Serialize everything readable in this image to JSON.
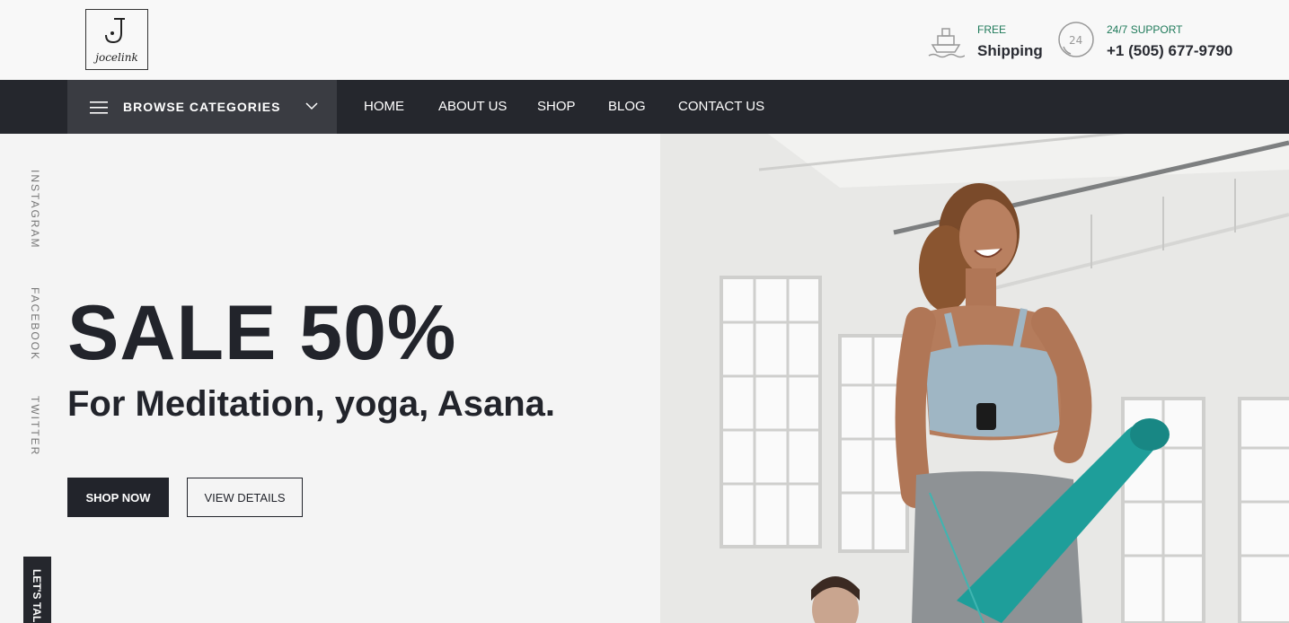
{
  "brand": {
    "logo_text": "jocelink"
  },
  "header": {
    "shipping": {
      "small": "FREE",
      "big": "Shipping",
      "icon": "ship-icon"
    },
    "support": {
      "small": "24/7 SUPPORT",
      "big": "+1 (505) 677-9790",
      "icon": "24h-support-icon"
    }
  },
  "nav": {
    "browse_label": "BROWSE CATEGORIES",
    "items": [
      "HOME",
      "ABOUT US",
      "SHOP",
      "BLOG",
      "CONTACT US"
    ]
  },
  "social": [
    "INSTAGRAM",
    "FACEBOOK",
    "TWITTER"
  ],
  "talk_label": "LET'S TALK",
  "hero": {
    "headline": "SALE 50%",
    "subline": "For Meditation, yoga, Asana.",
    "primary_button": "SHOP NOW",
    "secondary_button": "VIEW DETAILS"
  },
  "colors": {
    "dark": "#25272d",
    "accent_green": "#1f7a5a",
    "mat_teal": "#1e9e9a"
  }
}
